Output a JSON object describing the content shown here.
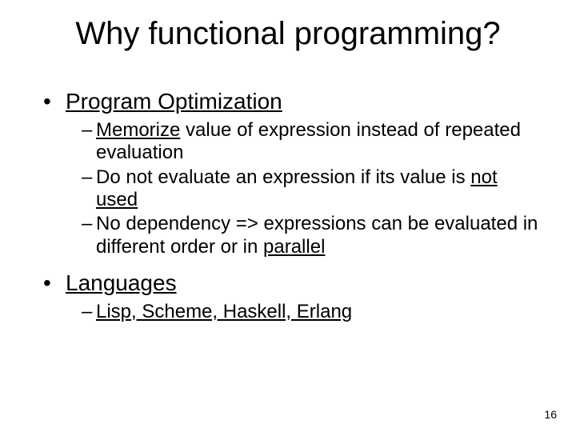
{
  "title": "Why functional programming?",
  "b1a": "Program Optimization",
  "s1_u": "Memorize",
  "s1_r": " value of expression instead of repeated evaluation",
  "s2_a": "Do not evaluate an expression if its value is ",
  "s2_u": "not used",
  "s3_a": "No dependency => expressions can be evaluated in different order or in ",
  "s3_u": "parallel",
  "b1b": "Languages",
  "s4_u": "Lisp, Scheme, Haskell, Erlang",
  "page": "16"
}
